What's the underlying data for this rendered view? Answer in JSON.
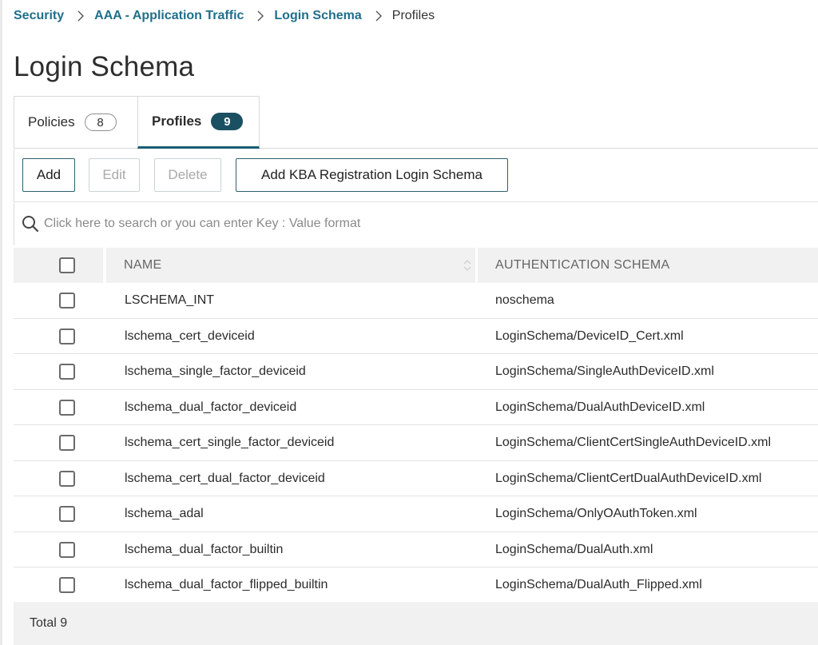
{
  "breadcrumb": {
    "items": [
      "Security",
      "AAA - Application Traffic",
      "Login Schema"
    ],
    "current": "Profiles"
  },
  "page_title": "Login Schema",
  "tabs": [
    {
      "label": "Policies",
      "count": "8",
      "active": false
    },
    {
      "label": "Profiles",
      "count": "9",
      "active": true
    }
  ],
  "toolbar": {
    "add_label": "Add",
    "edit_label": "Edit",
    "delete_label": "Delete",
    "kba_label": "Add KBA Registration Login Schema"
  },
  "search": {
    "placeholder": "Click here to search or you can enter Key : Value format",
    "value": ""
  },
  "table": {
    "columns": [
      "NAME",
      "AUTHENTICATION SCHEMA"
    ],
    "rows": [
      {
        "name": "LSCHEMA_INT",
        "schema": "noschema"
      },
      {
        "name": "lschema_cert_deviceid",
        "schema": "LoginSchema/DeviceID_Cert.xml"
      },
      {
        "name": "lschema_single_factor_deviceid",
        "schema": "LoginSchema/SingleAuthDeviceID.xml"
      },
      {
        "name": "lschema_dual_factor_deviceid",
        "schema": "LoginSchema/DualAuthDeviceID.xml"
      },
      {
        "name": "lschema_cert_single_factor_deviceid",
        "schema": "LoginSchema/ClientCertSingleAuthDeviceID.xml"
      },
      {
        "name": "lschema_cert_dual_factor_deviceid",
        "schema": "LoginSchema/ClientCertDualAuthDeviceID.xml"
      },
      {
        "name": "lschema_adal",
        "schema": "LoginSchema/OnlyOAuthToken.xml"
      },
      {
        "name": "lschema_dual_factor_builtin",
        "schema": "LoginSchema/DualAuth.xml"
      },
      {
        "name": "lschema_dual_factor_flipped_builtin",
        "schema": "LoginSchema/DualAuth_Flipped.xml"
      }
    ],
    "footer": "Total 9"
  },
  "colors": {
    "link": "#1f6f8b",
    "accent": "#1a5061",
    "button_border": "#2e5f6f"
  }
}
